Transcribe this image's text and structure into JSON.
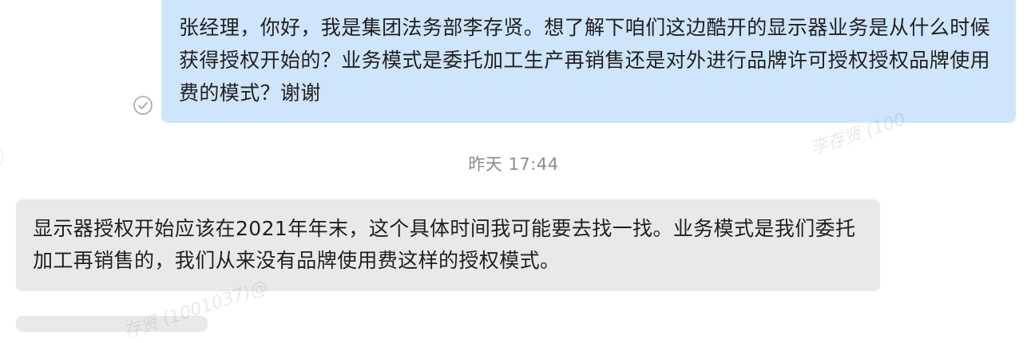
{
  "conversation": {
    "messages": [
      {
        "direction": "outgoing",
        "text": "张经理，你好，我是集团法务部李存贤。想了解下咱们这边酷开的显示器业务是从什么时候获得授权开始的？业务模式是委托加工生产再销售还是对外进行品牌许可授权授权品牌使用费的模式？谢谢",
        "status_icon": "read-check-icon"
      },
      {
        "direction": "incoming",
        "text": "显示器授权开始应该在2021年年末，这个具体时间我可能要去找一找。业务模式是我们委托加工再销售的，我们从来没有品牌使用费这样的授权模式。"
      }
    ],
    "timestamp": "昨天 17:44"
  },
  "watermark": {
    "text_right": "李存贤 (100",
    "text_left": "存贤 (1001037)@"
  },
  "colors": {
    "outgoing_bubble": "#cfe5fb",
    "incoming_bubble": "#e9e9e9",
    "timestamp_text": "#8c8c8c"
  }
}
